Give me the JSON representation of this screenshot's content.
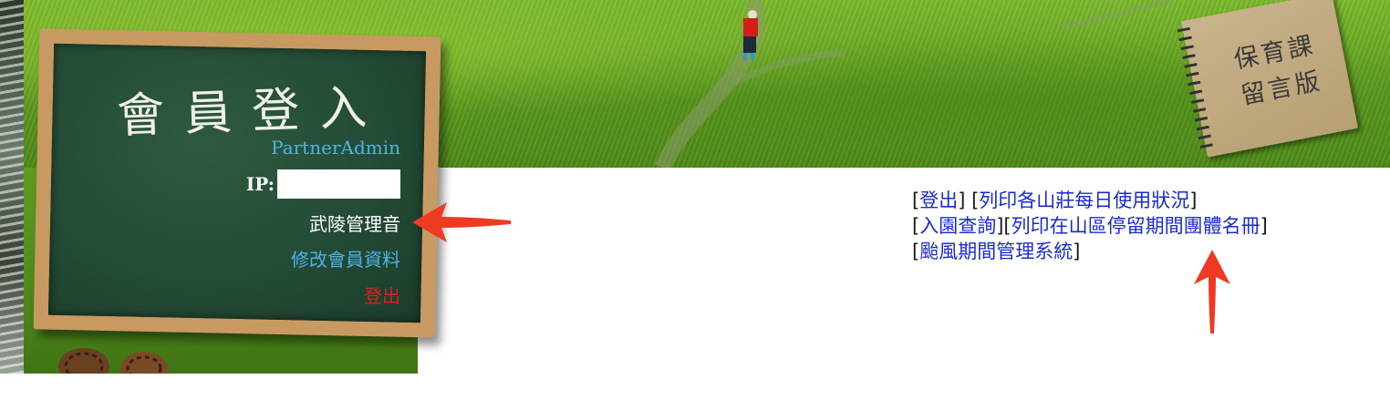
{
  "board": {
    "title": "會員登入",
    "username": "PartnerAdmin",
    "ip_label": "IP:",
    "station_name": "武陵管理音",
    "edit_profile_label": "修改會員資料",
    "logout_label": "登出"
  },
  "notebook": {
    "line1": "保育課",
    "line2": "留言版"
  },
  "links": {
    "logout": "登出",
    "print_daily_usage": "列印各山莊每日使用狀況",
    "entry_query": "入園查詢",
    "print_group_roster": "列印在山區停留期間團體名冊",
    "typhoon_system": "颱風期間管理系統"
  },
  "colors": {
    "link_blue": "#1a2ad0",
    "chalk_blue": "#4fb3e8",
    "logout_red": "#e0201a",
    "arrow_red": "#ee3a22",
    "grass_green": "#5e9c1f"
  },
  "annotations": {
    "arrow_left_icon": "red-arrow-pointing-left",
    "arrow_up_icon": "red-arrow-pointing-up"
  }
}
